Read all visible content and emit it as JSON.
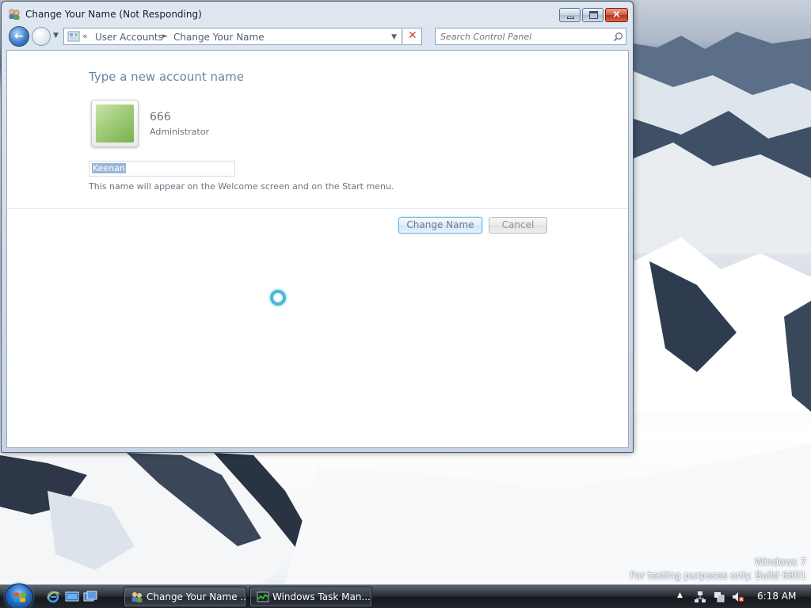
{
  "window": {
    "title": "Change Your Name (Not Responding)",
    "icon": "user-accounts-icon",
    "controls": {
      "minimize": "minimize-icon",
      "maximize": "maximize-icon",
      "close": "×"
    }
  },
  "navigation": {
    "back": "←",
    "breadcrumb_chevron": "«",
    "breadcrumb": [
      "User Accounts",
      "Change Your Name"
    ],
    "breadcrumb_separator": "►",
    "address_dropdown": "▼",
    "stop": "✕",
    "search_placeholder": "Search Control Panel"
  },
  "content": {
    "heading": "Type a new account name",
    "account": {
      "name": "666",
      "role": "Administrator"
    },
    "new_name_value": "Keenan",
    "hint": "This name will appear on the Welcome screen and on the Start menu.",
    "buttons": {
      "change": "Change Name",
      "cancel": "Cancel"
    },
    "busy": true
  },
  "desktop": {
    "watermark_line1": "Windows 7",
    "watermark_line2": "For testing purposes only. Build 6801"
  },
  "taskbar": {
    "start_icon": "windows-flag-icon",
    "quick_launch": [
      "internet-explorer-icon",
      "show-desktop-icon",
      "switch-windows-icon"
    ],
    "buttons": [
      {
        "label": "Change Your Name ...",
        "icon": "user-accounts-icon",
        "active": true
      },
      {
        "label": "Windows Task Man...",
        "icon": "task-manager-icon",
        "active": false
      }
    ],
    "tray": {
      "expand": "▲",
      "icons": [
        "network-icon",
        "action-center-icon",
        "volume-muted-icon"
      ]
    },
    "clock": "6:18 AM"
  },
  "colors": {
    "accent": "#6fb3e0",
    "heading": "#6a84a5",
    "taskbar": "#22272d"
  }
}
